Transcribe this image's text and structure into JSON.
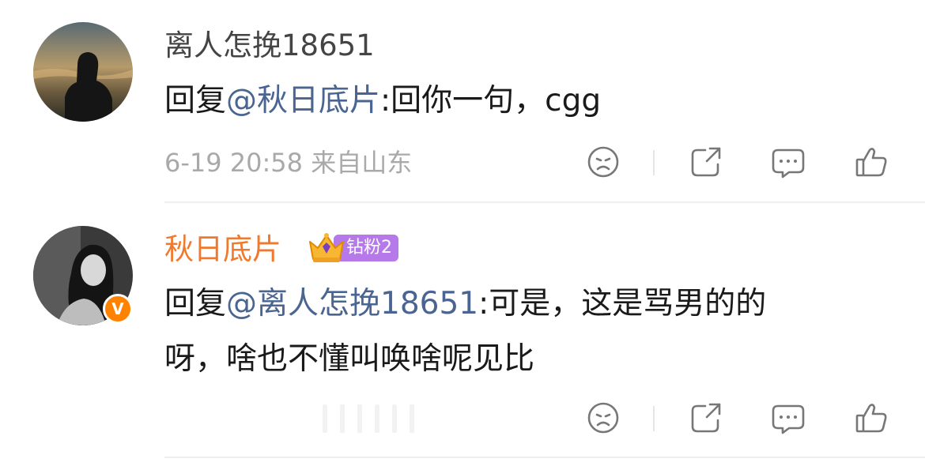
{
  "comments": [
    {
      "username": "离人怎挽18651",
      "reply_prefix": "回复",
      "mention": "@秋日底片",
      "text": ":回你一句，cgg",
      "time": "6-19 20:58",
      "location": "来自山东"
    },
    {
      "username": "秋日底片",
      "fan_badge": "钻粉2",
      "verified_mark": "V",
      "reply_prefix": "回复",
      "mention": "@离人怎挽18651",
      "text_line1": ":可是，这是骂男的的",
      "text_line2": "呀，啥也不懂叫唤啥呢见比"
    }
  ],
  "colors": {
    "mention": "#4a6591",
    "username_vip": "#f0792d",
    "meta": "#a9a9a9",
    "fan_badge": "#b679ea",
    "verified": "#ff8200"
  },
  "icons": [
    "dislike-face-icon",
    "share-icon",
    "comment-icon",
    "like-thumb-icon"
  ]
}
